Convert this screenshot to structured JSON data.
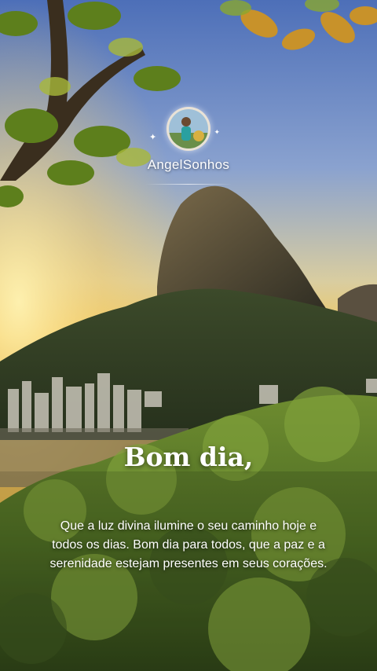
{
  "profile": {
    "username": "AngelSonhos",
    "avatar_icon": "user-avatar-icon"
  },
  "post": {
    "greeting": "Bom dia,",
    "message": "Que a luz divina ilumine o seu caminho hoje e todos os dias. Bom dia para todos, que a paz e a serenidade estejam presentes em seus corações."
  },
  "colors": {
    "sky_top": "#5f7fc4",
    "sunset": "#f3c45a",
    "foliage": "#6b8a2a",
    "text": "#ffffff"
  }
}
